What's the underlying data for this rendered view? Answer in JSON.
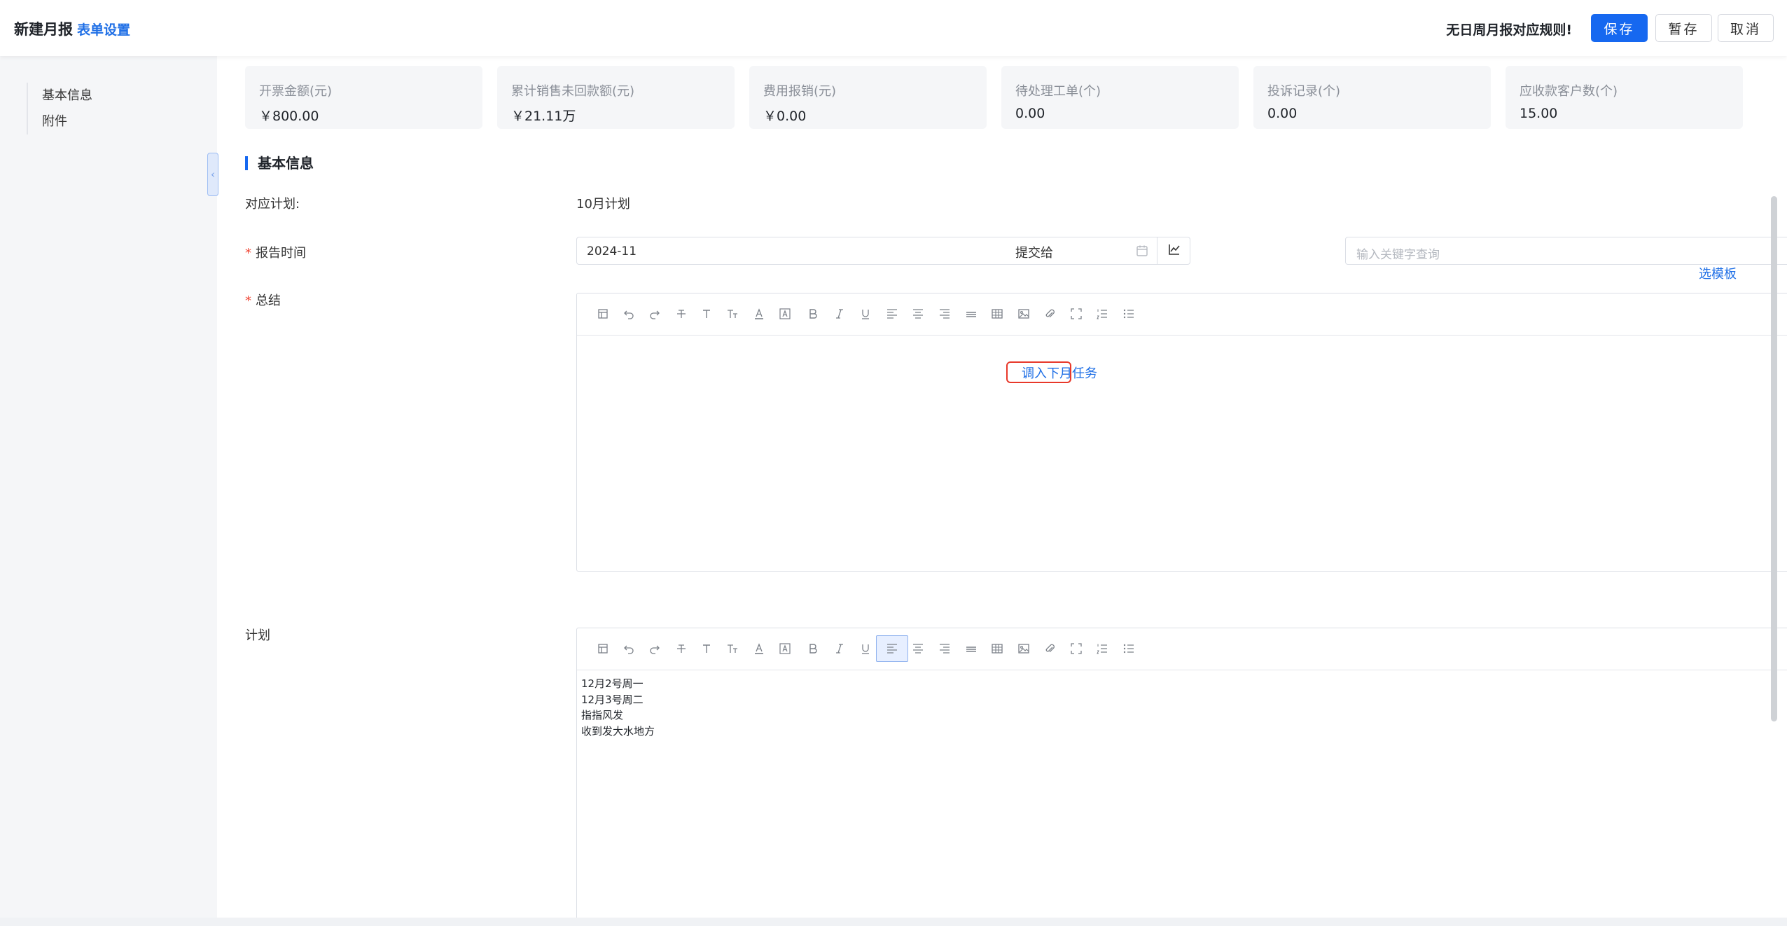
{
  "header": {
    "title": "新建月报",
    "form_settings": "表单设置",
    "warning": "无日周月报对应规则!",
    "save": "保存",
    "draft": "暂存",
    "cancel": "取消"
  },
  "sidebar": {
    "items": [
      {
        "label": "基本信息"
      },
      {
        "label": "附件"
      }
    ]
  },
  "stats": [
    {
      "label": "开票金额(元)",
      "value": "￥800.00"
    },
    {
      "label": "累计销售未回款额(元)",
      "value": "￥21.11万"
    },
    {
      "label": "费用报销(元)",
      "value": "￥0.00"
    },
    {
      "label": "待处理工单(个)",
      "value": "0.00"
    },
    {
      "label": "投诉记录(个)",
      "value": "0.00"
    },
    {
      "label": "应收款客户数(个)",
      "value": "15.00"
    }
  ],
  "section": {
    "title": "基本信息"
  },
  "form": {
    "plan_label": "对应计划:",
    "plan_value": "10月计划",
    "required_mark": "*",
    "report_time_label": "报告时间",
    "report_time_value": "2024-11",
    "submit_to_label": "提交给",
    "submit_to_placeholder": "输入关键字查询",
    "more": "···",
    "choose_template": "选模板",
    "summary_label": "总结",
    "import_tasks": "调入下月任务",
    "plan_editor_label": "计划",
    "plan_lines": [
      "12月2号周一",
      "12月3号周二",
      "指指风发",
      "收到发大水地方"
    ]
  },
  "toolbar_icons": [
    "format-painter-icon",
    "undo-icon",
    "redo-icon",
    "strikethrough-icon",
    "font-size-icon",
    "text-size-icon",
    "font-color-icon",
    "background-color-icon",
    "bold-icon",
    "italic-icon",
    "underline-icon",
    "align-left-icon",
    "align-center-icon",
    "align-right-icon",
    "justify-icon",
    "table-icon",
    "image-icon",
    "attachment-icon",
    "fullscreen-icon",
    "ordered-list-icon",
    "unordered-list-icon"
  ],
  "colors": {
    "primary": "#1668f0",
    "required": "#f04a3a",
    "highlight_border": "#e8382a"
  }
}
